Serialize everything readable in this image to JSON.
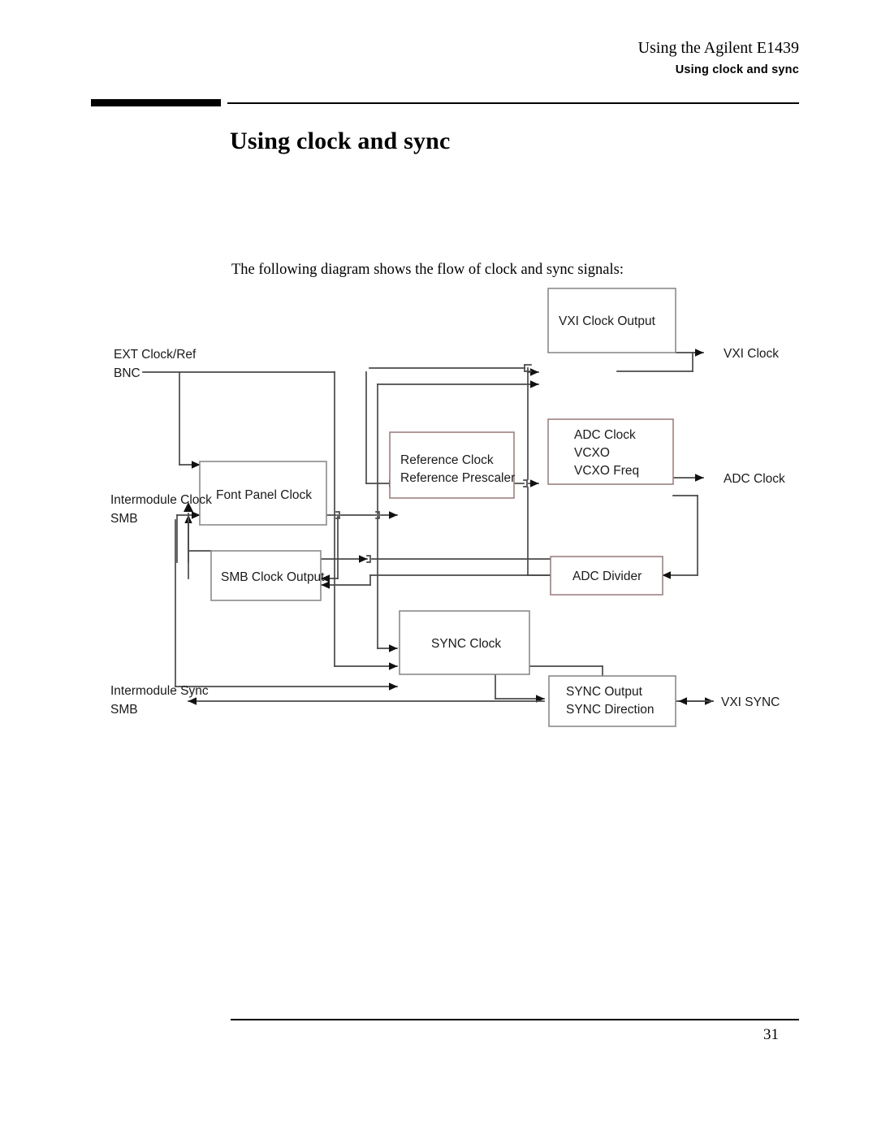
{
  "header": {
    "chapter": "Using the Agilent E1439",
    "section": "Using clock and sync"
  },
  "title": "Using clock and sync",
  "intro": "The following diagram shows the flow of clock and sync signals:",
  "footer": {
    "page_number": "31"
  },
  "diagram": {
    "boxes": {
      "vxi_clock_output": "VXI Clock Output",
      "adc_clock_line1": "ADC Clock",
      "adc_clock_line2": "VCXO",
      "adc_clock_line3": "VCXO Freq",
      "reference_clock_line1": "Reference Clock",
      "reference_clock_line2": "Reference Prescaler",
      "font_panel_clock": "Font Panel Clock",
      "smb_clock_output": "SMB Clock Output",
      "adc_divider": "ADC Divider",
      "sync_clock": "SYNC Clock",
      "sync_output_line1": "SYNC Output",
      "sync_output_line2": "SYNC Direction"
    },
    "ports": {
      "ext_clock_ref_line1": "EXT Clock/Ref",
      "ext_clock_ref_line2": "BNC",
      "intermodule_clock_line1": "Intermodule Clock",
      "intermodule_clock_line2": "SMB",
      "intermodule_sync_line1": "Intermodule Sync",
      "intermodule_sync_line2": "SMB",
      "vxi_clock": "VXI Clock",
      "adc_clock": "ADC Clock",
      "vxi_sync": "VXI SYNC"
    }
  },
  "colors": {
    "ink": "#000000",
    "box_stroke": "#8a8a8a",
    "box_stroke_warm": "#9c8280",
    "connector": "#4a4a4a"
  }
}
